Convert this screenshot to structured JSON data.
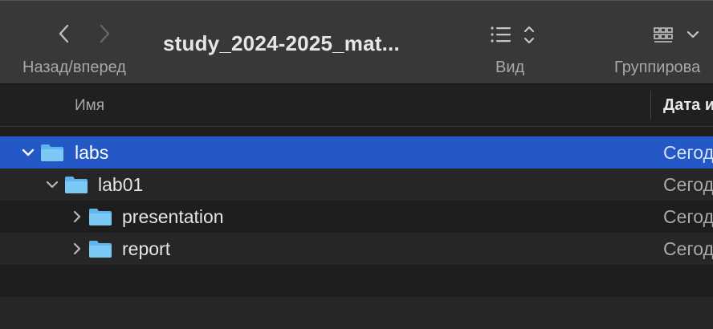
{
  "toolbar": {
    "nav_label": "Назад/вперед",
    "title": "study_2024-2025_mat...",
    "view_label": "Вид",
    "group_label": "Группирова"
  },
  "columns": {
    "name": "Имя",
    "date": "Дата и"
  },
  "rows": [
    {
      "name": "labs",
      "date": "Сегод",
      "expanded": true,
      "selected": true
    },
    {
      "name": "lab01",
      "date": "Сегод",
      "expanded": true,
      "selected": false
    },
    {
      "name": "presentation",
      "date": "Сегод",
      "expanded": false,
      "selected": false
    },
    {
      "name": "report",
      "date": "Сегод",
      "expanded": false,
      "selected": false
    }
  ],
  "colors": {
    "toolbar_bg": "#383838",
    "selection": "#2458c7",
    "folder": "#5fb6ee"
  },
  "icons": [
    "chevron-left-icon",
    "chevron-right-icon",
    "list-view-icon",
    "up-down-icon",
    "group-icon",
    "chevron-down-icon",
    "folder-icon",
    "disclosure-icon"
  ]
}
